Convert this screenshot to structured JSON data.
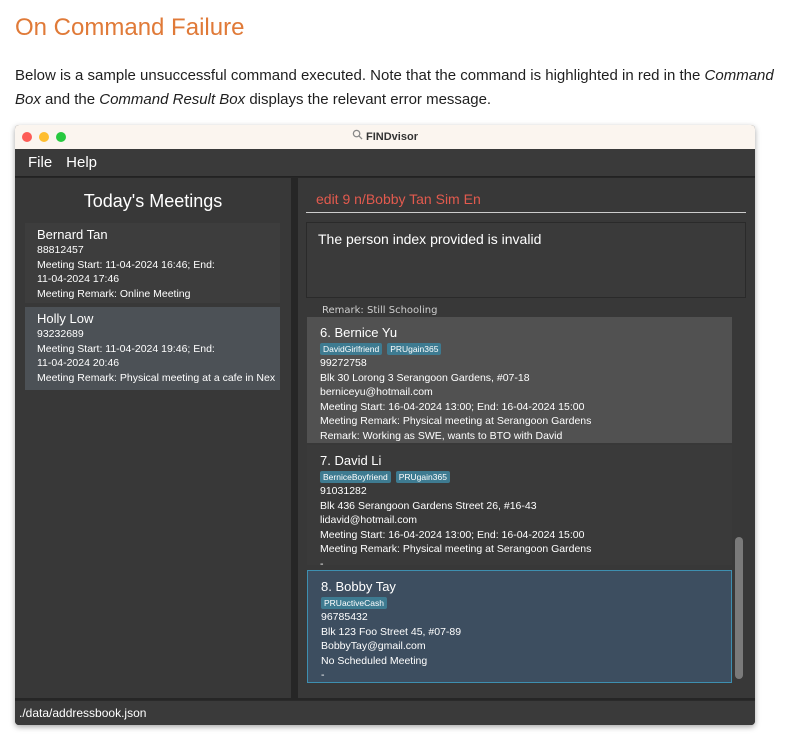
{
  "doc": {
    "heading": "On Command Failure",
    "para_part1": "Below is a sample unsuccessful command executed. Note that the command is highlighted in red in the ",
    "para_em1": "Command Box",
    "para_part2": " and the ",
    "para_em2": "Command Result Box",
    "para_part3": " displays the relevant error message."
  },
  "window": {
    "title": "FINDvisor",
    "title_icon": "search-icon"
  },
  "menu": {
    "file": "File",
    "help": "Help"
  },
  "meetings": {
    "title": "Today's Meetings",
    "items": [
      {
        "name": "Bernard Tan",
        "phone": "88812457",
        "start_line": "Meeting Start: 11-04-2024 16:46; End:",
        "end_line": "11-04-2024 17:46",
        "remark": "Meeting Remark: Online Meeting"
      },
      {
        "name": "Holly Low",
        "phone": "93232689",
        "start_line": "Meeting Start: 11-04-2024 19:46; End:",
        "end_line": "11-04-2024 20:46",
        "remark": "Meeting Remark: Physical meeting at a cafe in Nex"
      }
    ]
  },
  "command": {
    "text": "edit 9 n/Bobby Tan Sim En",
    "color": "#e25a4e"
  },
  "result": {
    "text": "The person index provided is invalid"
  },
  "persons": {
    "peek": "Remark: Still Schooling",
    "items": [
      {
        "name": "6.  Bernice Yu",
        "tags": [
          "DavidGirlfriend",
          "PRUgain365"
        ],
        "phone": "99272758",
        "address": "Blk 30 Lorong 3 Serangoon Gardens, #07-18",
        "email": "berniceyu@hotmail.com",
        "meeting": "Meeting Start: 16-04-2024 13:00; End: 16-04-2024 15:00",
        "meeting_remark": "Meeting Remark: Physical meeting at Serangoon Gardens",
        "remark": "Remark: Working as SWE, wants to BTO with David"
      },
      {
        "name": "7.  David Li",
        "tags": [
          "BerniceBoyfriend",
          "PRUgain365"
        ],
        "phone": "91031282",
        "address": "Blk 436 Serangoon Gardens Street 26, #16-43",
        "email": "lidavid@hotmail.com",
        "meeting": "Meeting Start: 16-04-2024 13:00; End: 16-04-2024 15:00",
        "meeting_remark": "Meeting Remark: Physical meeting at Serangoon Gardens",
        "remark": "-"
      },
      {
        "name": "8.  Bobby Tay",
        "tags": [
          "PRUactiveCash"
        ],
        "phone": "96785432",
        "address": "Blk 123 Foo Street 45, #07-89",
        "email": "BobbyTay@gmail.com",
        "meeting": "No Scheduled Meeting",
        "remark": "-"
      }
    ]
  },
  "status": {
    "path": "./data/addressbook.json"
  }
}
